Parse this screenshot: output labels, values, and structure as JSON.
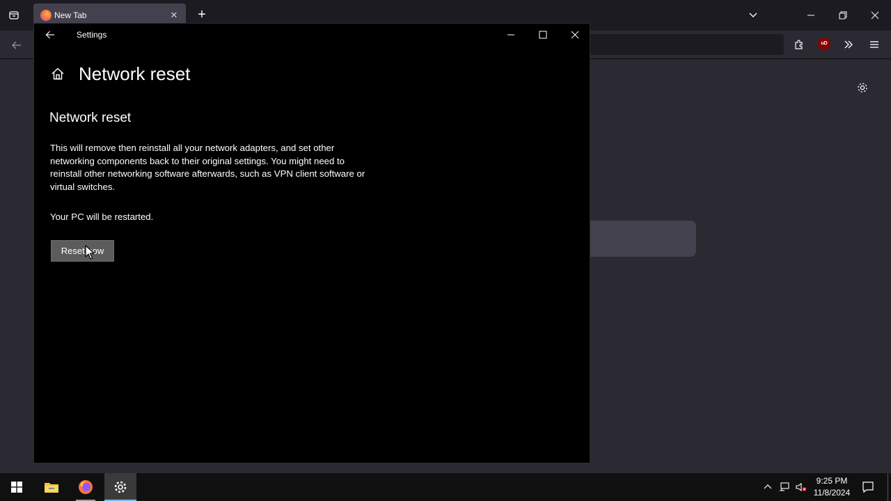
{
  "browser": {
    "tab": {
      "title": "New Tab"
    },
    "icons": [
      "list-all-tabs-icon",
      "firefox-favicon",
      "close-icon",
      "plus-icon",
      "chevron-down-icon",
      "back-arrow-icon",
      "extensions-icon",
      "ublock-icon",
      "overflow-icon",
      "hamburger-menu-icon",
      "gear-icon"
    ],
    "ublock_label": "uD"
  },
  "settings": {
    "window_title": "Settings",
    "page_title": "Network reset",
    "section_heading": "Network reset",
    "description": "This will remove then reinstall all your network adapters, and set other networking components back to their original settings. You might need to reinstall other networking software afterwards, such as VPN client software or virtual switches.",
    "restart_note": "Your PC will be restarted.",
    "reset_button_label": "Reset now"
  },
  "taskbar": {
    "time": "9:25 PM",
    "date": "11/8/2024",
    "pinned": [
      "File Explorer",
      "Firefox",
      "Settings"
    ],
    "active_app": "Settings"
  },
  "colors": {
    "settings_bg": "#000000",
    "browser_bg": "#2b2a33",
    "taskbar_bg": "#101010",
    "accent": "#76b9ed",
    "button_bg": "#5c5c5c"
  }
}
